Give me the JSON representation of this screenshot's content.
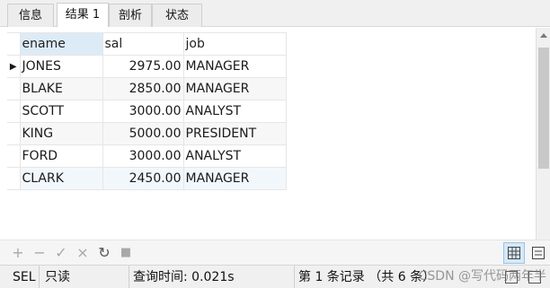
{
  "tabs": [
    {
      "label": "信息"
    },
    {
      "label": "结果 1"
    },
    {
      "label": "剖析"
    },
    {
      "label": "状态"
    }
  ],
  "grid": {
    "columns": [
      "ename",
      "sal",
      "job"
    ],
    "rows": [
      {
        "ename": "JONES",
        "sal": "2975.00",
        "job": "MANAGER"
      },
      {
        "ename": "BLAKE",
        "sal": "2850.00",
        "job": "MANAGER"
      },
      {
        "ename": "SCOTT",
        "sal": "3000.00",
        "job": "ANALYST"
      },
      {
        "ename": "KING",
        "sal": "5000.00",
        "job": "PRESIDENT"
      },
      {
        "ename": "FORD",
        "sal": "3000.00",
        "job": "ANALYST"
      },
      {
        "ename": "CLARK",
        "sal": "2450.00",
        "job": "MANAGER"
      }
    ],
    "current_row_marker": "▶"
  },
  "toolbar": {
    "add": "+",
    "remove": "−",
    "apply": "✓",
    "discard": "×",
    "refresh": "↻",
    "stop": "■",
    "grid_view_icon": "grid-icon",
    "form_view_icon": "form-icon"
  },
  "statusbar": {
    "sql_snippet": "SEL",
    "readonly": "只读",
    "query_time": "查询时间: 0.021s",
    "record_info": "第 1 条记录 （共 6 条）"
  },
  "watermark": "CSDN @写代码两年半",
  "colors": {
    "header_selected": "#ddebf7",
    "scroll_thumb": "#c8c8c8",
    "active_view_button": "#d6e8f7"
  }
}
